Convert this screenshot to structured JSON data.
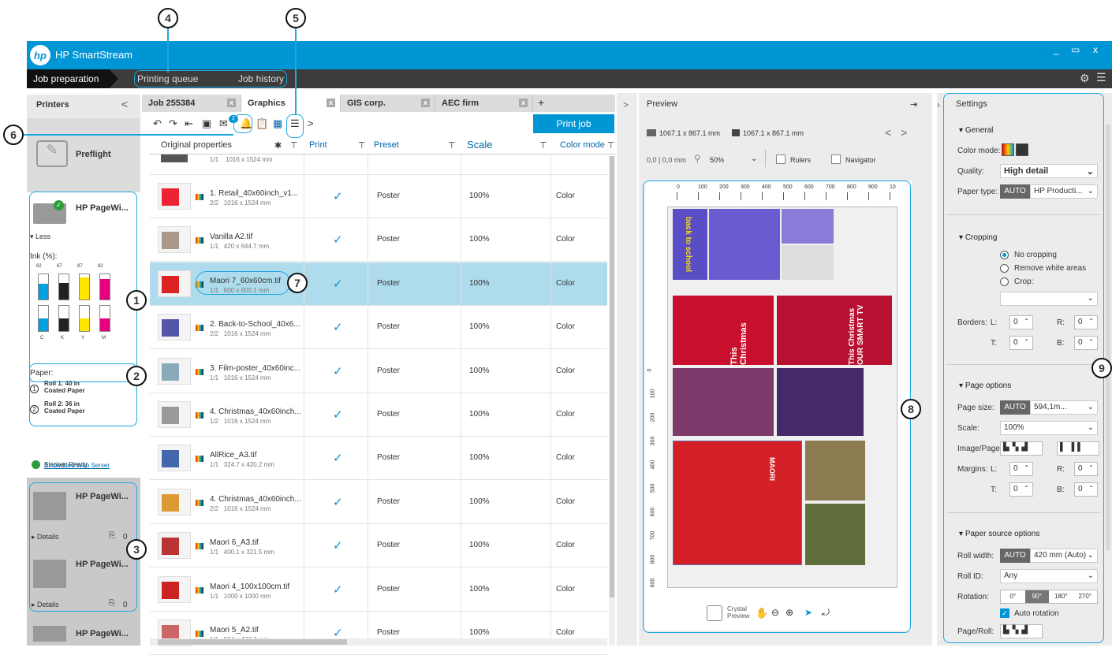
{
  "app": {
    "title": "HP SmartStream",
    "logo": "hp",
    "window_controls": [
      "_",
      "▭",
      "x"
    ]
  },
  "nav": {
    "active": "Job preparation",
    "items": [
      "Printing queue",
      "Job history"
    ]
  },
  "callouts": [
    "1",
    "2",
    "3",
    "4",
    "5",
    "6",
    "7",
    "8",
    "9"
  ],
  "printers": {
    "title": "Printers",
    "collapse": "<",
    "preflight": "Preflight",
    "printer1": {
      "name": "HP PageWi...",
      "less": "Less",
      "ink_label": "Ink (%):",
      "inks": [
        {
          "label": "C",
          "pct": "62",
          "top": "62",
          "color": "#00a0e0"
        },
        {
          "label": "K",
          "pct": "67",
          "top": "67",
          "color": "#222"
        },
        {
          "label": "Y",
          "pct": "87",
          "top": "87",
          "color": "#ffe600"
        },
        {
          "label": "M",
          "pct": "82",
          "top": "82",
          "color": "#e6007e"
        }
      ],
      "paper_label": "Paper:",
      "roll1": "Roll 1: 40 in",
      "roll1_type": "Coated Paper",
      "roll2": "Roll 2: 36 in",
      "roll2_type": "Coated Paper",
      "r1": "1",
      "r2": "2"
    },
    "stacker": "Stacker: Ready",
    "ews": "Embedded Web Server",
    "other": [
      {
        "name": "HP PageWi...",
        "details": "Details",
        "count": "0"
      },
      {
        "name": "HP PageWi...",
        "details": "Details",
        "count": "0"
      },
      {
        "name": "HP PageWi..."
      }
    ]
  },
  "jobtabs": [
    {
      "label": "Job 255384"
    },
    {
      "label": "Graphics"
    },
    {
      "label": "GIS corp."
    },
    {
      "label": "AEC firm"
    }
  ],
  "add_tab": "+",
  "close": "x",
  "toolbar": {
    "print_job": "Print job",
    "badge": "2",
    "more": ">"
  },
  "columns": {
    "original": "Original properties",
    "print": "Print",
    "preset": "Preset",
    "scale": "Scale",
    "color_mode": "Color mode"
  },
  "top_row": {
    "count": "1/1",
    "dim": "1016 x 1524 mm"
  },
  "rows": [
    {
      "name": "1. Retail_40x60inch_v1...",
      "count": "2/2",
      "dim": "1016 x 1524 mm",
      "preset": "Poster",
      "scale": "100%",
      "color": "Color",
      "check": "✓",
      "thumb": "#e23"
    },
    {
      "name": "Vanilla A2.tif",
      "count": "1/1",
      "dim": "420 x 644.7 mm",
      "preset": "Poster",
      "scale": "100%",
      "color": "Color",
      "check": "✓",
      "thumb": "#a98"
    },
    {
      "name": "Maori 7_60x60cm.tif",
      "count": "1/1",
      "dim": "600 x 600.1 mm",
      "preset": "Poster",
      "scale": "100%",
      "color": "Color",
      "check": "✓",
      "thumb": "#d22"
    },
    {
      "name": "2. Back-to-School_40x6...",
      "count": "2/2",
      "dim": "1016 x 1524 mm",
      "preset": "Poster",
      "scale": "100%",
      "color": "Color",
      "check": "✓",
      "thumb": "#55a"
    },
    {
      "name": "3. Film-poster_40x60inc...",
      "count": "1/1",
      "dim": "1016 x 1524 mm",
      "preset": "Poster",
      "scale": "100%",
      "color": "Color",
      "check": "✓",
      "thumb": "#8ab"
    },
    {
      "name": "4. Christmas_40x60inch...",
      "count": "1/2",
      "dim": "1016 x 1524 mm",
      "preset": "Poster",
      "scale": "100%",
      "color": "Color",
      "check": "✓",
      "thumb": "#999"
    },
    {
      "name": "AllRice_A3.tif",
      "count": "1/1",
      "dim": "324.7 x 420.2 mm",
      "preset": "Poster",
      "scale": "100%",
      "color": "Color",
      "check": "✓",
      "thumb": "#46a"
    },
    {
      "name": "4. Christmas_40x60inch...",
      "count": "2/2",
      "dim": "1016 x 1524 mm",
      "preset": "Poster",
      "scale": "100%",
      "color": "Color",
      "check": "✓",
      "thumb": "#d93"
    },
    {
      "name": "Maori 6_A3.tif",
      "count": "1/1",
      "dim": "400.1 x 321.5 mm",
      "preset": "Poster",
      "scale": "100%",
      "color": "Color",
      "check": "✓",
      "thumb": "#b33"
    },
    {
      "name": "Maori 4_100x100cm.tif",
      "count": "1/1",
      "dim": "1000 x 1000 mm",
      "preset": "Poster",
      "scale": "100%",
      "color": "Color",
      "check": "✓",
      "thumb": "#c22"
    },
    {
      "name": "Maori 5_A2.tif",
      "count": "1/1",
      "dim": "594 x 477.7 mm",
      "preset": "Poster",
      "scale": "100%",
      "color": "Color",
      "check": "✓",
      "thumb": "#c66"
    }
  ],
  "preview": {
    "title": "Preview",
    "arrow": ">",
    "size1": "1067.1 x 867.1 mm",
    "size2": "1067.1 x 867.1 mm",
    "nav": "<  >",
    "coords": "0,0 | 0,0 mm",
    "zoom": "50%",
    "rulers": "Rulers",
    "navigator": "Navigator",
    "crystal": "Crystal Preview",
    "ruler_top": [
      "0",
      "100",
      "200",
      "300",
      "400",
      "500",
      "600",
      "700",
      "800",
      "900",
      "10"
    ],
    "ruler_left": [
      "0",
      "100",
      "200",
      "300",
      "400",
      "500",
      "600",
      "700",
      "800",
      "900"
    ],
    "tiles": [
      "back to school",
      "This Christmas",
      "This Christmas OUR SMART TV",
      "MAORI"
    ]
  },
  "settings": {
    "title": "Settings",
    "general": "General",
    "color_mode": "Color mode:",
    "quality": "Quality:",
    "quality_val": "High detail",
    "paper_type": "Paper type:",
    "auto": "AUTO",
    "paper_val": "HP Producti...",
    "cropping": "Cropping",
    "no_crop": "No cropping",
    "remove": "Remove white areas",
    "crop": "Crop:",
    "borders": "Borders:",
    "L": "L:",
    "R": "R:",
    "T": "T:",
    "B": "B:",
    "zero": "0",
    "page_options": "Page options",
    "page_size": "Page size:",
    "page_size_val": "594,1m...",
    "scale": "Scale:",
    "scale_val": "100%",
    "image_page": "Image/Page:",
    "margins": "Margins:",
    "paper_source": "Paper source options",
    "roll_width": "Roll width:",
    "roll_width_val": "420 mm (Auto)",
    "roll_id": "Roll ID:",
    "roll_id_val": "Any",
    "rotation": "Rotation:",
    "rot": [
      "0°",
      "90°",
      "180°",
      "270°"
    ],
    "auto_rot": "Auto rotation",
    "page_roll": "Page/Roll:"
  }
}
